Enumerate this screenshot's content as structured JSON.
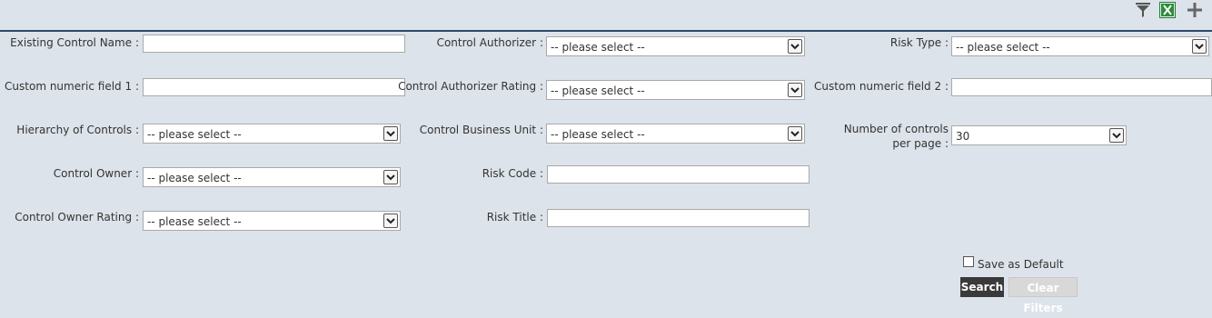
{
  "toolbar": {
    "filter_icon": "filter-icon",
    "excel_icon": "excel-icon",
    "add_icon": "plus-icon"
  },
  "fields": {
    "existing_control_name": {
      "label": "Existing Control Name",
      "colon": ":",
      "value": ""
    },
    "custom_numeric_1": {
      "label": "Custom numeric field 1",
      "colon": ":",
      "value": ""
    },
    "hierarchy_of_controls": {
      "label": "Hierarchy of Controls",
      "colon": ":",
      "value": "-- please select --"
    },
    "control_owner": {
      "label": "Control Owner",
      "colon": ":",
      "value": "-- please select --"
    },
    "control_owner_rating": {
      "label": "Control Owner Rating",
      "colon": ":",
      "value": "-- please select --"
    },
    "control_authorizer": {
      "label": "Control Authorizer",
      "colon": ":",
      "value": "-- please select --"
    },
    "control_authorizer_rating": {
      "label": "Control Authorizer Rating",
      "colon": ":",
      "value": "-- please select --"
    },
    "control_business_unit": {
      "label": "Control Business Unit",
      "colon": ":",
      "value": "-- please select --"
    },
    "risk_code": {
      "label": "Risk Code",
      "colon": ":",
      "value": ""
    },
    "risk_title": {
      "label": "Risk Title",
      "colon": ":",
      "value": ""
    },
    "risk_type": {
      "label": "Risk Type",
      "colon": ":",
      "value": "-- please select --"
    },
    "custom_numeric_2": {
      "label": "Custom numeric field 2",
      "colon": ":",
      "value": ""
    },
    "controls_per_page": {
      "label": "Number of controls per page",
      "colon": ":",
      "value": "30"
    }
  },
  "save_default": {
    "label": "Save as Default",
    "checked": false
  },
  "buttons": {
    "search": "Search",
    "clear": "Clear Filters"
  },
  "colors": {
    "background": "#dde3ea",
    "header_rule": "#2d4a6b",
    "search_bg": "#3a3a3a",
    "excel_green": "#1e7e34"
  }
}
